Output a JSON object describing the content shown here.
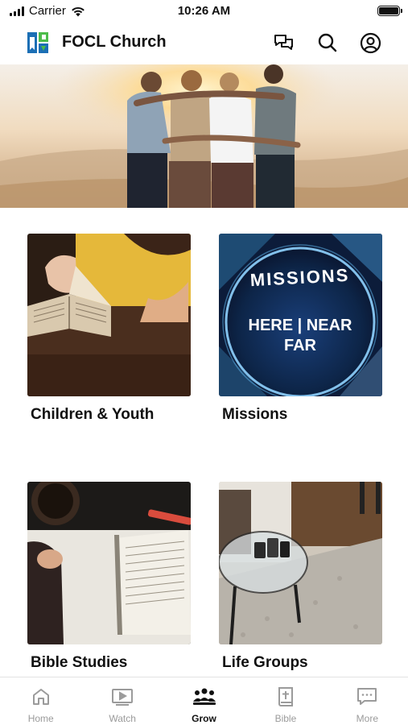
{
  "status": {
    "carrier": "Carrier",
    "time": "10:26 AM"
  },
  "header": {
    "title": "FOCL Church",
    "icons": [
      "chat-bubbles-icon",
      "search-icon",
      "account-icon"
    ]
  },
  "hero": {
    "description": "group-hug-sunset-photo"
  },
  "cards": [
    {
      "label": "Children & Youth"
    },
    {
      "label": "Missions",
      "image_text": {
        "top": "MISSIONS",
        "middle": "HERE | NEAR",
        "bottom": "FAR"
      }
    },
    {
      "label": "Bible Studies"
    },
    {
      "label": "Life Groups"
    }
  ],
  "tabs": [
    {
      "label": "Home",
      "icon": "home-icon",
      "active": false
    },
    {
      "label": "Watch",
      "icon": "play-video-icon",
      "active": false
    },
    {
      "label": "Grow",
      "icon": "group-icon",
      "active": true
    },
    {
      "label": "Bible",
      "icon": "bible-icon",
      "active": false
    },
    {
      "label": "More",
      "icon": "more-chat-icon",
      "active": false
    }
  ],
  "colors": {
    "active_tab": "#111111",
    "inactive_tab": "#9b9b9b",
    "logo_blue": "#1b6fb5",
    "logo_green": "#4cbc4a"
  }
}
